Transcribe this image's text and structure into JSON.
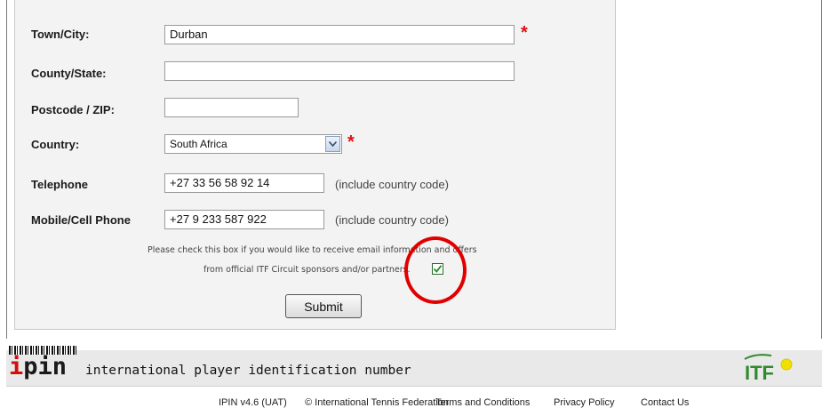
{
  "form": {
    "town_label": "Town/City:",
    "town_value": "Durban",
    "county_label": "County/State:",
    "county_value": "",
    "postcode_label": "Postcode / ZIP:",
    "postcode_value": "",
    "country_label": "Country:",
    "country_value": "South Africa",
    "telephone_label": "Telephone",
    "telephone_value": "+27 33 56 58 92 14",
    "mobile_label": "Mobile/Cell Phone",
    "mobile_value": "+27 9 233 587 922",
    "country_code_hint": "(include country code)",
    "required_marker": "*",
    "consent_line1": "Please check this box if you would like to receive email information and offers",
    "consent_line2": "from official ITF Circuit sponsors and/or partners.",
    "consent_checked": true,
    "submit_label": "Submit"
  },
  "footer": {
    "logo_i": "i",
    "logo_rest": "pin",
    "tagline": "international player identification number",
    "itf_logo_text": "ITF",
    "version": "IPIN v4.6 (UAT)",
    "copyright": "© International Tennis Federation",
    "terms_link": "Terms and Conditions",
    "privacy_link": "Privacy Policy",
    "contact_link": "Contact Us"
  },
  "colors": {
    "required": "#e01010",
    "annotation_circle": "#e00000",
    "itf_green": "#2e8b2e",
    "tennis_ball": "#f0e000"
  },
  "icons": [
    "dropdown-arrow-icon",
    "checkmark-icon",
    "barcode-icon",
    "itf-logo-icon"
  ]
}
